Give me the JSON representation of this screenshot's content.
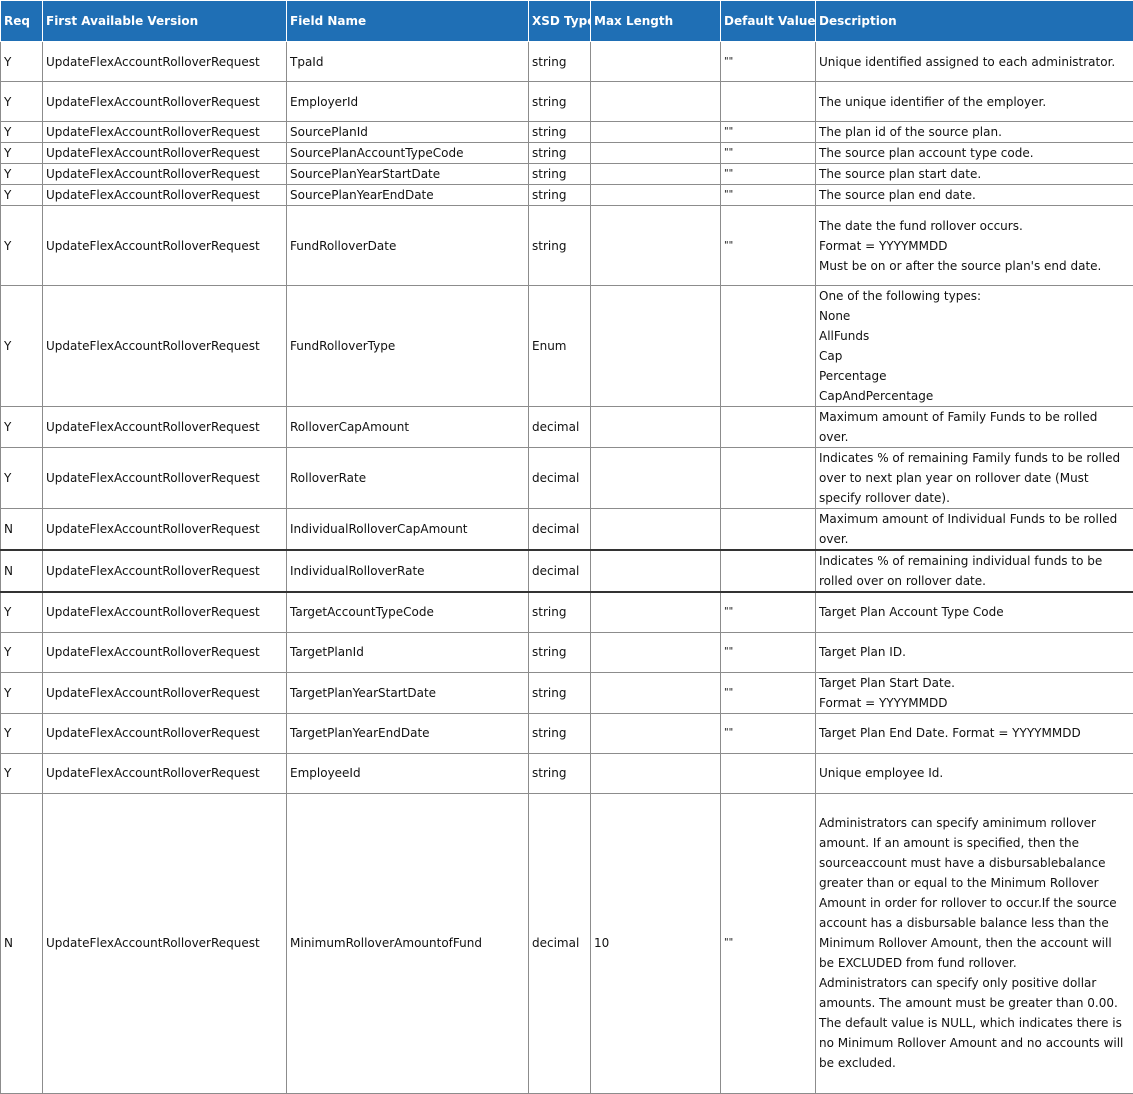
{
  "header": [
    "Req",
    "First Available Version",
    "Field Name",
    "XSD Type",
    "Max Length",
    "Default Value",
    "Description"
  ],
  "rows": [
    {
      "req": "Y",
      "version": "UpdateFlexAccountRolloverRequest",
      "field": "TpaId",
      "xsd": "string",
      "max": "",
      "def": "\"\"",
      "desc": [
        "Unique identified assigned to each administrator."
      ]
    },
    {
      "req": "Y",
      "version": "UpdateFlexAccountRolloverRequest",
      "field": "EmployerId",
      "xsd": "string",
      "max": "",
      "def": "",
      "desc": [
        "The unique identifier of the employer."
      ]
    },
    {
      "req": "Y",
      "version": "UpdateFlexAccountRolloverRequest",
      "field": "SourcePlanId",
      "xsd": "string",
      "max": "",
      "def": "\"\"",
      "desc": [
        "The plan id of the source plan."
      ]
    },
    {
      "req": "Y",
      "version": "UpdateFlexAccountRolloverRequest",
      "field": "SourcePlanAccountTypeCode",
      "xsd": "string",
      "max": "",
      "def": "\"\"",
      "desc": [
        "The source plan account type code."
      ]
    },
    {
      "req": "Y",
      "version": "UpdateFlexAccountRolloverRequest",
      "field": "SourcePlanYearStartDate",
      "xsd": "string",
      "max": "",
      "def": "\"\"",
      "desc": [
        "The source plan start date."
      ]
    },
    {
      "req": "Y",
      "version": "UpdateFlexAccountRolloverRequest",
      "field": "SourcePlanYearEndDate",
      "xsd": "string",
      "max": "",
      "def": "\"\"",
      "desc": [
        "The source plan end date."
      ]
    },
    {
      "req": "Y",
      "version": "UpdateFlexAccountRolloverRequest",
      "field": "FundRolloverDate",
      "xsd": "string",
      "max": "",
      "def": "\"\"",
      "desc": [
        "The date the fund rollover occurs.",
        "Format = YYYYMMDD",
        "Must be on or after the source plan's end date."
      ]
    },
    {
      "req": "Y",
      "version": "UpdateFlexAccountRolloverRequest",
      "field": "FundRolloverType",
      "xsd": "Enum",
      "max": "",
      "def": "",
      "desc": [
        "One of the following types:",
        "None",
        "AllFunds",
        "Cap",
        "Percentage",
        "CapAndPercentage"
      ]
    },
    {
      "req": "Y",
      "version": "UpdateFlexAccountRolloverRequest",
      "field": "RolloverCapAmount",
      "xsd": "decimal",
      "max": "",
      "def": "",
      "desc": [
        "Maximum amount of Family Funds to be rolled over."
      ]
    },
    {
      "req": "Y",
      "version": "UpdateFlexAccountRolloverRequest",
      "field": "RolloverRate",
      "xsd": "decimal",
      "max": "",
      "def": "",
      "desc": [
        "Indicates % of remaining Family funds to be rolled over to next plan year on rollover date (Must specify rollover date)."
      ]
    },
    {
      "req": "N",
      "version": "UpdateFlexAccountRolloverRequest",
      "field": "IndividualRolloverCapAmount",
      "xsd": "decimal",
      "max": "",
      "def": "",
      "desc": [
        "Maximum amount of Individual Funds to be rolled over."
      ]
    },
    {
      "req": "N",
      "version": "UpdateFlexAccountRolloverRequest",
      "field": "IndividualRolloverRate",
      "xsd": "decimal",
      "max": "",
      "def": "",
      "desc": [
        "Indicates % of remaining individual funds to be rolled over on rollover date."
      ]
    },
    {
      "req": "Y",
      "version": "UpdateFlexAccountRolloverRequest",
      "field": "TargetAccountTypeCode",
      "xsd": "string",
      "max": "",
      "def": "\"\"",
      "desc": [
        "Target Plan Account Type Code"
      ]
    },
    {
      "req": "Y",
      "version": "UpdateFlexAccountRolloverRequest",
      "field": "TargetPlanId",
      "xsd": "string",
      "max": "",
      "def": "\"\"",
      "desc": [
        "Target Plan ID."
      ]
    },
    {
      "req": "Y",
      "version": "UpdateFlexAccountRolloverRequest",
      "field": "TargetPlanYearStartDate",
      "xsd": "string",
      "max": "",
      "def": "\"\"",
      "desc": [
        "Target Plan Start Date.",
        "Format = YYYYMMDD"
      ]
    },
    {
      "req": "Y",
      "version": "UpdateFlexAccountRolloverRequest",
      "field": "TargetPlanYearEndDate",
      "xsd": "string",
      "max": "",
      "def": "\"\"",
      "desc": [
        "Target Plan End Date. Format = YYYYMMDD"
      ]
    },
    {
      "req": "Y",
      "version": "UpdateFlexAccountRolloverRequest",
      "field": "EmployeeId",
      "xsd": "string",
      "max": "",
      "def": "",
      "desc": [
        "Unique employee Id."
      ]
    },
    {
      "req": "N",
      "version": "UpdateFlexAccountRolloverRequest",
      "field": "MinimumRolloverAmountofFund",
      "xsd": "decimal",
      "max": "10",
      "def": "\"\"",
      "desc": [
        "Administrators can specify aminimum rollover amount. If an amount is specified, then the sourceaccount must have a disbursablebalance greater than or equal to the Minimum Rollover Amount in order for rollover to occur.If the source account has a disbursable balance less than the Minimum Rollover Amount, then the account will be EXCLUDED from fund rollover.",
        "Administrators can specify only positive dollar amounts. The amount must be greater than 0.00. The default value is NULL, which indicates there is no Minimum Rollover Amount and no accounts will be excluded."
      ]
    }
  ]
}
